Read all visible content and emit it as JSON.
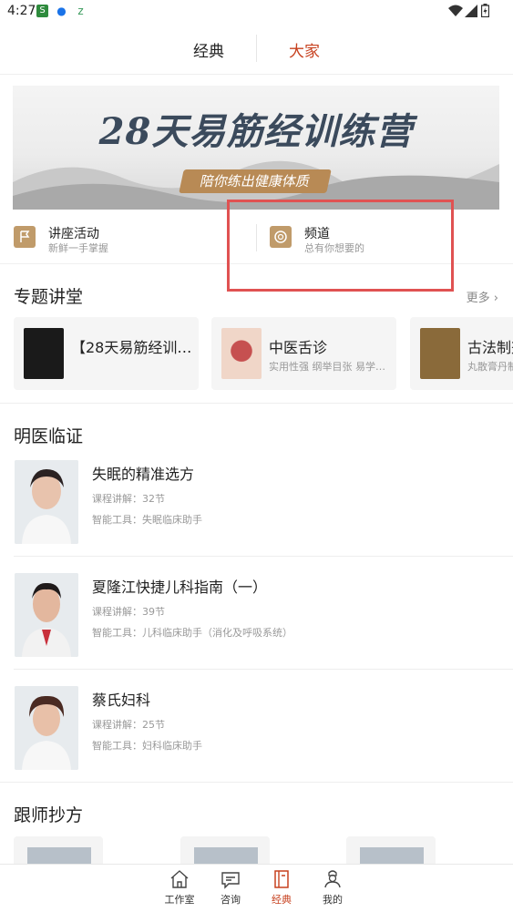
{
  "status": {
    "time": "4:27"
  },
  "topnav": {
    "tabs": [
      {
        "label": "经典",
        "active": false
      },
      {
        "label": "大家",
        "active": true
      }
    ],
    "active_color": "#c7411f"
  },
  "banner": {
    "title": "28天易筋经训练营",
    "subtitle": "陪你练出健康体质"
  },
  "entries": [
    {
      "title": "讲座活动",
      "subtitle": "新鲜一手掌握",
      "icon": "flag-icon"
    },
    {
      "title": "频道",
      "subtitle": "总有你想要的",
      "icon": "channel-icon"
    }
  ],
  "topics": {
    "title": "专题讲堂",
    "more_label": "更多",
    "cards": [
      {
        "title": "【28天易筋经训…",
        "subtitle": ""
      },
      {
        "title": "中医舌诊",
        "subtitle": "实用性强 纲举目张 易学…"
      },
      {
        "title": "古法制剂",
        "subtitle": "丸散膏丹制"
      }
    ]
  },
  "doctors": {
    "title": "明医临证",
    "items": [
      {
        "name": "失眠的精准选方",
        "lessons": "课程讲解：32节",
        "tool": "智能工具：失眠临床助手"
      },
      {
        "name": "夏隆江快捷儿科指南（一）",
        "lessons": "课程讲解：39节",
        "tool": "智能工具：儿科临床助手（消化及呼吸系统）"
      },
      {
        "name": "蔡氏妇科",
        "lessons": "课程讲解：25节",
        "tool": "智能工具：妇科临床助手"
      }
    ]
  },
  "follow": {
    "title": "跟师抄方"
  },
  "tabbar": {
    "items": [
      {
        "label": "工作室",
        "icon": "home-icon",
        "active": false
      },
      {
        "label": "咨询",
        "icon": "chat-icon",
        "active": false
      },
      {
        "label": "经典",
        "icon": "book-icon",
        "active": true
      },
      {
        "label": "我的",
        "icon": "user-icon",
        "active": false
      }
    ]
  }
}
